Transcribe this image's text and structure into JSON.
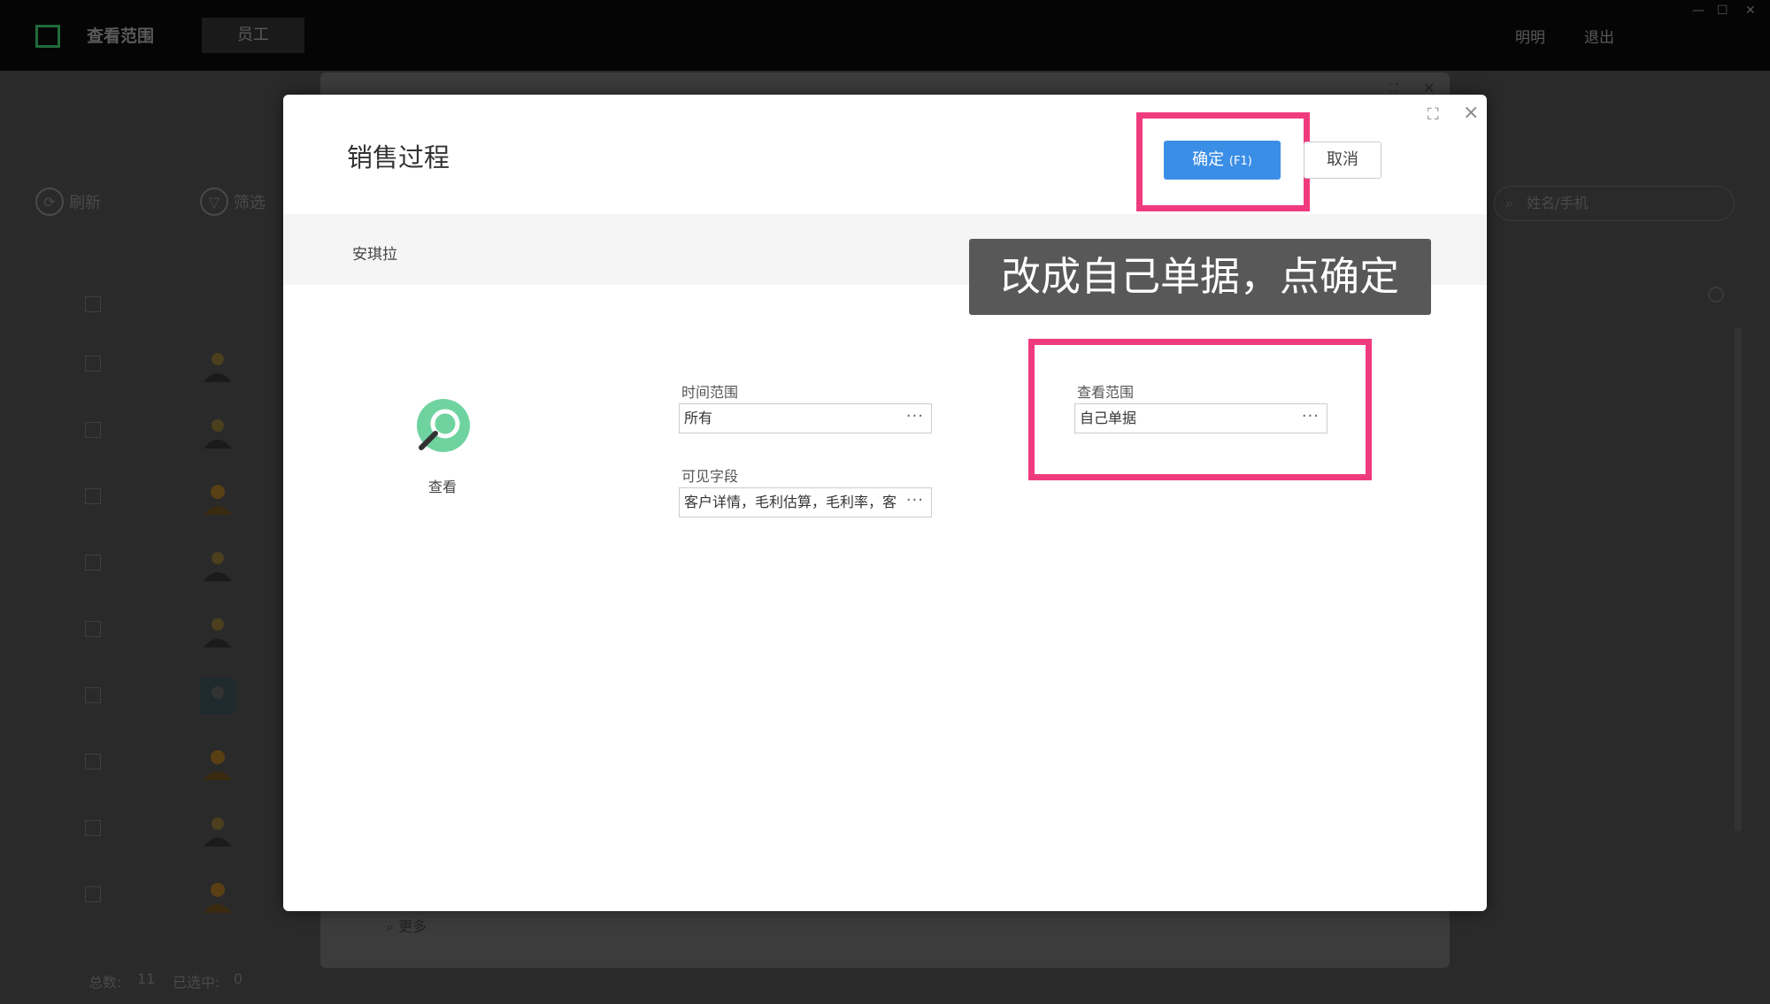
{
  "topbar": {
    "title": "查看范围",
    "tab_label": "员工",
    "user_link": "明明",
    "logout_link": "退出",
    "window_controls": {
      "minimize": "—",
      "maximize": "☐",
      "close": "✕"
    }
  },
  "background": {
    "refresh_label": "刷新",
    "filter_label": "筛选",
    "search_placeholder": "姓名/手机",
    "footer_total_label": "总数:",
    "footer_total": "11",
    "footer_selected_label": "已选中:",
    "footer_selected": "0",
    "more_label": "更多"
  },
  "dialog": {
    "title": "销售过程",
    "ok_label": "确定",
    "ok_shortcut": "(F1)",
    "cancel_label": "取消",
    "user_name": "安琪拉",
    "tip_text": "改成自己单据，点确定",
    "permission_label": "查看",
    "fields": {
      "time_range": {
        "label": "时间范围",
        "value": "所有"
      },
      "visible_fields": {
        "label": "可见字段",
        "value": "客户详情，毛利估算，毛利率，客"
      },
      "view_scope": {
        "label": "查看范围",
        "value": "自己单据"
      }
    }
  },
  "colors": {
    "primary": "#3b8ee6",
    "highlight": "#ef3b7d",
    "tip_bg": "#585858"
  }
}
